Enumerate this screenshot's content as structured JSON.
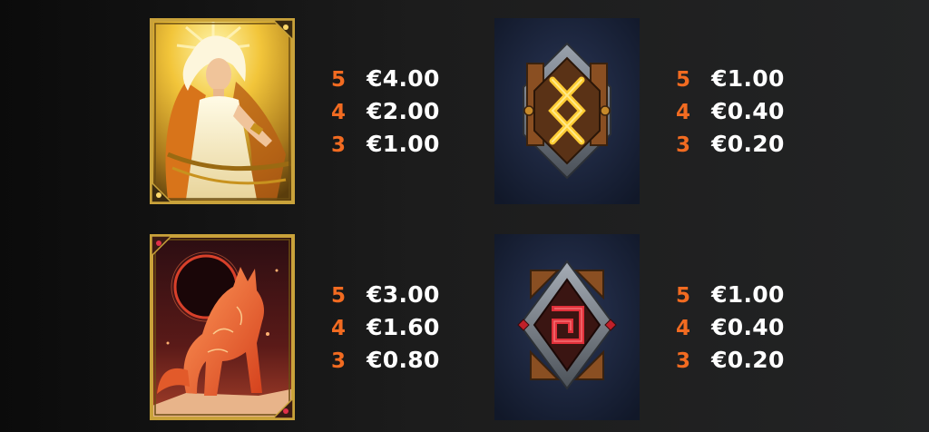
{
  "colors": {
    "count": "#f26b21",
    "value": "#ffffff",
    "background": "#1a1a1a",
    "card_gold": "#c9a23a",
    "card_navy": "#1a2238"
  },
  "symbols": [
    {
      "icon": "sun-goddess-icon",
      "payouts": [
        {
          "count": "5",
          "value": "€4.00"
        },
        {
          "count": "4",
          "value": "€2.00"
        },
        {
          "count": "3",
          "value": "€1.00"
        }
      ]
    },
    {
      "icon": "gold-rune-shield-icon",
      "payouts": [
        {
          "count": "5",
          "value": "€1.00"
        },
        {
          "count": "4",
          "value": "€0.40"
        },
        {
          "count": "3",
          "value": "€0.20"
        }
      ]
    },
    {
      "icon": "fire-wolf-icon",
      "payouts": [
        {
          "count": "5",
          "value": "€3.00"
        },
        {
          "count": "4",
          "value": "€1.60"
        },
        {
          "count": "3",
          "value": "€0.80"
        }
      ]
    },
    {
      "icon": "red-rune-shield-icon",
      "payouts": [
        {
          "count": "5",
          "value": "€1.00"
        },
        {
          "count": "4",
          "value": "€0.40"
        },
        {
          "count": "3",
          "value": "€0.20"
        }
      ]
    }
  ]
}
